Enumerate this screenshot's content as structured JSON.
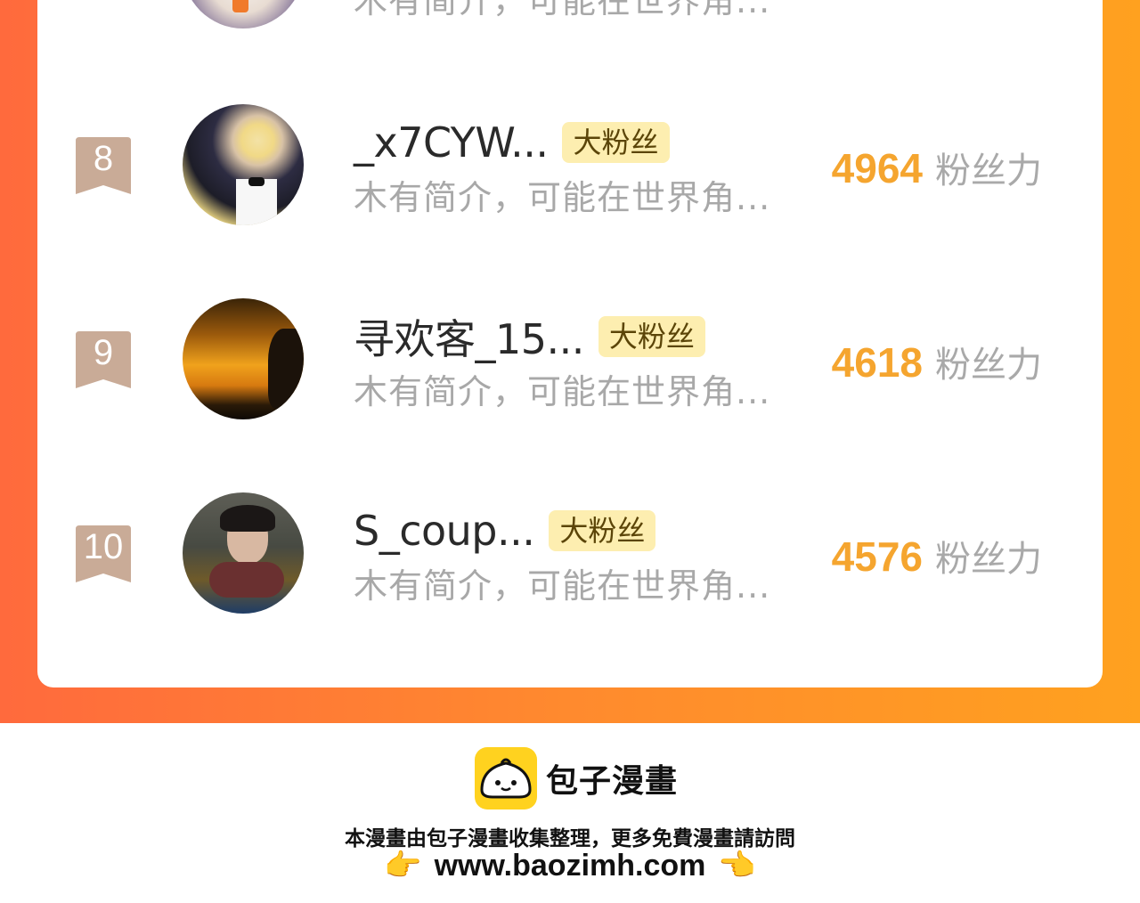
{
  "rows": [
    {
      "rank": "8",
      "name": "_x7CYW...",
      "badge": "大粉丝",
      "desc": "木有简介，可能在世界角...",
      "score": "4964",
      "unit": "粉丝力"
    },
    {
      "rank": "9",
      "name": "寻欢客_15...",
      "badge": "大粉丝",
      "desc": "木有简介，可能在世界角...",
      "score": "4618",
      "unit": "粉丝力"
    },
    {
      "rank": "10",
      "name": "S_coup...",
      "badge": "大粉丝",
      "desc": "木有简介，可能在世界角...",
      "score": "4576",
      "unit": "粉丝力"
    }
  ],
  "partial_row": {
    "desc": "木有简介，可能在世界角..."
  },
  "footer": {
    "brand": "包子漫畫",
    "notice": "本漫畫由包子漫畫收集整理，更多免費漫畫請訪問",
    "url": "www.baozimh.com",
    "hand_left": "👉",
    "hand_right": "👈"
  },
  "colors": {
    "accent": "#f5a52f",
    "badge_bg": "#fdeeb0",
    "rank_bg": "#c9ab97",
    "frame_left": "#ff6a3d",
    "frame_right": "#ffa11f"
  }
}
